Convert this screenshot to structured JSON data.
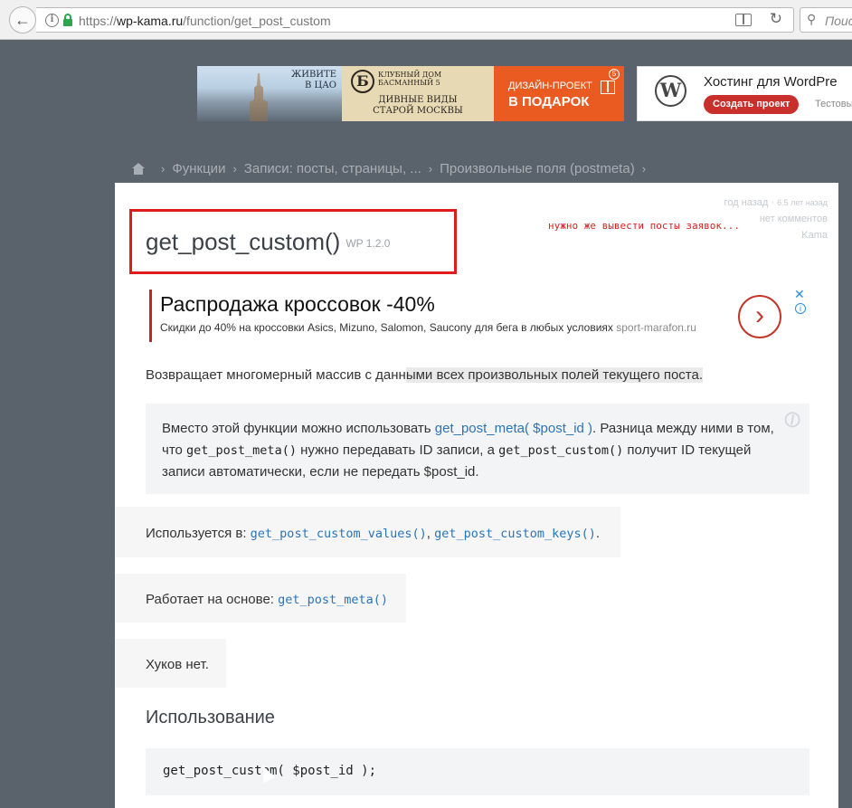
{
  "browser": {
    "url_scheme": "https://",
    "url_host": "wp-kama.ru",
    "url_path": "/function/get_post_custom",
    "search_placeholder": "Поис"
  },
  "ads": {
    "banner1": {
      "live_line1": "ЖИВИТЕ",
      "live_line2": "В ЦАО",
      "logo_letter": "Б",
      "club_line1": "КЛУБНЫЙ ДОМ",
      "club_line2": "БАСМАННЫЙ 5",
      "views_line1": "ДИВНЫЕ ВИДЫ",
      "views_line2": "СТАРОЙ МОСКВЫ",
      "promo_line1": "ДИЗАЙН-ПРОЕКТ",
      "promo_line2": "В ПОДАРОК",
      "badge": "5"
    },
    "banner2": {
      "title": "Хостинг для WordPre",
      "button": "Создать проект",
      "sub": "Тестовы"
    },
    "inline": {
      "headline": "Распродажа кроссовок -40%",
      "desc": "Скидки до 40% на кроссовки Asics, Mizuno, Salomon, Saucony для бега в любых условиях",
      "domain": "sport-marafon.ru",
      "close": "✕",
      "info": "i"
    }
  },
  "breadcrumb": [
    "Функции",
    "Записи: посты, страницы, ...",
    "Произвольные поля (postmeta)"
  ],
  "breadcrumb_sep": "›",
  "meta": {
    "date": "год назад",
    "date_small": "6.5 лет назад",
    "comments": "нет комментов",
    "author": "Kama"
  },
  "title": "get_post_custom()",
  "version": "WP 1.2.0",
  "annotation": "нужно же вывести посты заявок...",
  "description_a": "Возвращает многомерный массив с данн",
  "description_b": "ыми всех произвольных полей текущего поста.",
  "note": {
    "t1": "Вместо этой функции можно использовать ",
    "link": "get_post_meta( $post_id )",
    "t2": ". Разница между ними в том, что ",
    "code1": "get_post_meta()",
    "t3": " нужно передавать ID записи, а ",
    "code2": "get_post_custom()",
    "t4": " получит ID текущей записи автоматически, если не передать $post_id."
  },
  "used_in": {
    "label": "Используется в: ",
    "link1": "get_post_custom_values()",
    "sep": ", ",
    "link2": "get_post_custom_keys()",
    "end": "."
  },
  "based_on": {
    "label": "Работает на основе: ",
    "link": "get_post_meta()"
  },
  "hooks": "Хуков нет.",
  "usage_heading": "Использование",
  "code": "get_post_custom( $post_id );",
  "colors": {
    "highlight_frame": "#e01b1b",
    "link": "#2a74b8",
    "ad_accent": "#e95b21"
  }
}
